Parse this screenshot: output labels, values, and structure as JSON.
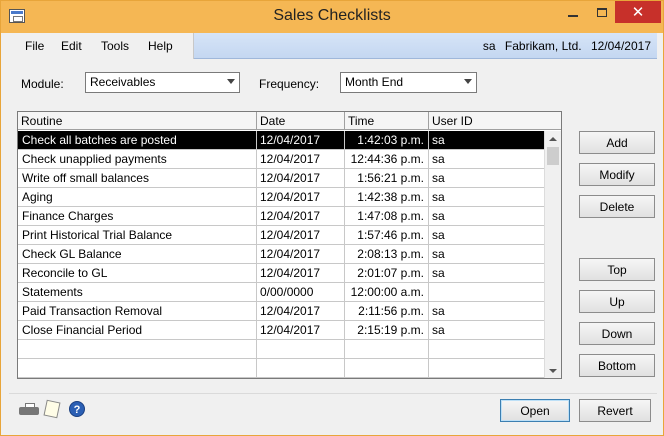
{
  "window": {
    "title": "Sales Checklists",
    "close_glyph": "✕"
  },
  "menu": {
    "items": [
      "File",
      "Edit",
      "Tools",
      "Help"
    ],
    "user": "sa",
    "company": "Fabrikam, Ltd.",
    "date": "12/04/2017"
  },
  "filters": {
    "module_label": "Module:",
    "module_value": "Receivables",
    "frequency_label": "Frequency:",
    "frequency_value": "Month End"
  },
  "table": {
    "columns": [
      "Routine",
      "Date",
      "Time",
      "User ID"
    ],
    "rows": [
      {
        "routine": "Check all batches are posted",
        "date": "12/04/2017",
        "time": "1:42:03 p.m.",
        "user": "sa",
        "selected": true
      },
      {
        "routine": "Check unapplied payments",
        "date": "12/04/2017",
        "time": "12:44:36 p.m.",
        "user": "sa"
      },
      {
        "routine": "Write off small balances",
        "date": "12/04/2017",
        "time": "1:56:21 p.m.",
        "user": "sa"
      },
      {
        "routine": "Aging",
        "date": "12/04/2017",
        "time": "1:42:38 p.m.",
        "user": "sa"
      },
      {
        "routine": "Finance Charges",
        "date": "12/04/2017",
        "time": "1:47:08 p.m.",
        "user": "sa"
      },
      {
        "routine": "Print Historical Trial Balance",
        "date": "12/04/2017",
        "time": "1:57:46 p.m.",
        "user": "sa"
      },
      {
        "routine": "Check GL Balance",
        "date": "12/04/2017",
        "time": "2:08:13 p.m.",
        "user": "sa"
      },
      {
        "routine": "Reconcile to GL",
        "date": "12/04/2017",
        "time": "2:01:07 p.m.",
        "user": "sa"
      },
      {
        "routine": "Statements",
        "date": "0/00/0000",
        "time": "12:00:00 a.m.",
        "user": ""
      },
      {
        "routine": "Paid Transaction Removal",
        "date": "12/04/2017",
        "time": "2:11:56 p.m.",
        "user": "sa"
      },
      {
        "routine": "Close Financial Period",
        "date": "12/04/2017",
        "time": "2:15:19 p.m.",
        "user": "sa"
      },
      {
        "routine": "",
        "date": "",
        "time": "",
        "user": ""
      },
      {
        "routine": "",
        "date": "",
        "time": "",
        "user": ""
      }
    ]
  },
  "buttons": {
    "add": "Add",
    "modify": "Modify",
    "delete": "Delete",
    "top": "Top",
    "up": "Up",
    "down": "Down",
    "bottom": "Bottom",
    "open": "Open",
    "revert": "Revert"
  },
  "icons": {
    "help": "?"
  }
}
